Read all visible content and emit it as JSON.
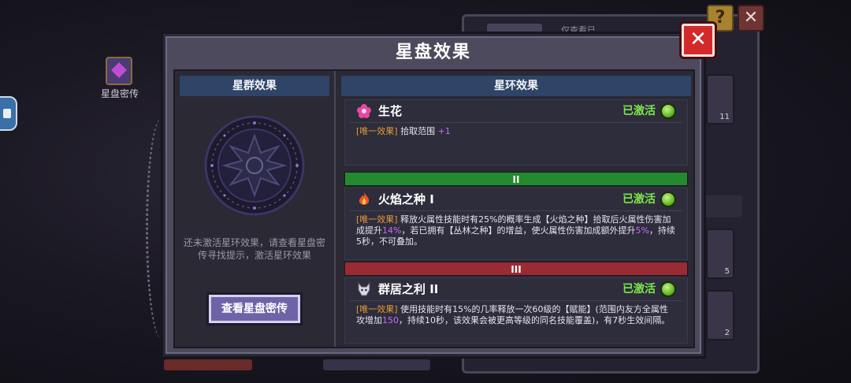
{
  "background": {
    "starchart_label": "星盘密传",
    "panel_text": "仅查看已",
    "help_glyph": "?",
    "close_glyph": "✕",
    "slot_counts": [
      "11",
      "5",
      "2"
    ]
  },
  "dialog": {
    "title": "星盘效果",
    "close_glyph": "✕",
    "left": {
      "header": "星群效果",
      "hint": "还未激活星环效果，请查看星盘密传寻找提示，激活星环效果",
      "button": "查看星盘密传"
    },
    "right": {
      "header": "星环效果",
      "effects": [
        {
          "name": "生花",
          "status": "已激活",
          "tag": "[唯一效果]",
          "text_1": "拾取范围",
          "val_1": "+1",
          "text_2": ""
        },
        {
          "name": "火焰之种 I",
          "status": "已激活",
          "tag": "[唯一效果]",
          "text_1": "释放火属性技能时有25%的概率生成【火焰之种】拾取后火属性伤害加成提升",
          "val_1": "14%",
          "text_2": "，若已拥有【丛林之种】的增益，使火属性伤害加成额外提升",
          "val_2": "5%",
          "text_3": "，持续5秒，不可叠加。"
        },
        {
          "name": "群居之利 II",
          "status": "已激活",
          "tag": "[唯一效果]",
          "text_1": "使用技能时有15%的几率释放一次60级的【赋能】(范围内友方全属性攻增加",
          "val_1": "150",
          "text_2": "，持续10秒，该效果会被更高等级的同名技能覆盖)，有7秒生效间隔。"
        }
      ],
      "tiers": [
        "II",
        "III"
      ]
    }
  },
  "colors": {
    "active_green": "#7de64a",
    "tag_orange": "#e59a3a",
    "value_purple": "#c86bff",
    "tier2": "#238a2e",
    "tier3": "#9a2a34",
    "close_red": "#d22a2a"
  }
}
